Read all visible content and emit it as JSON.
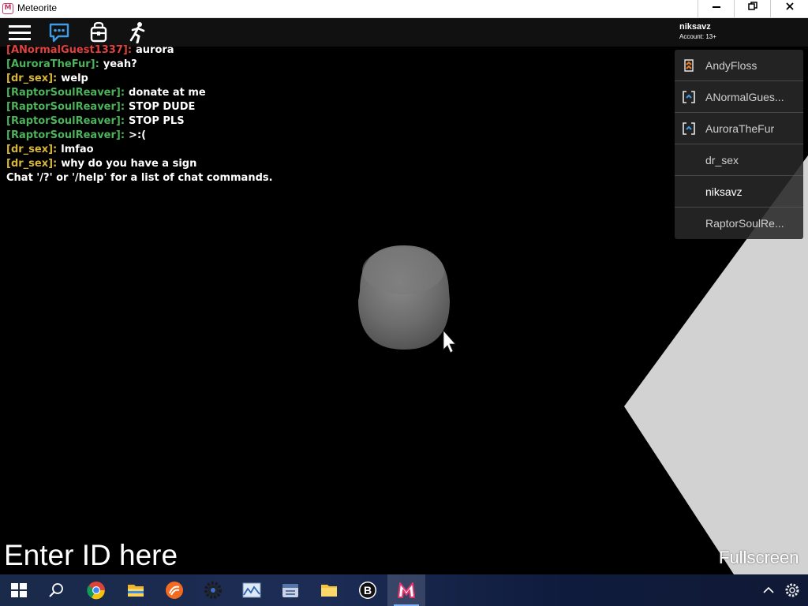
{
  "window": {
    "title": "Meteorite",
    "icon_letter": "M",
    "controls": [
      "minimize",
      "maximize",
      "close"
    ]
  },
  "account": {
    "name": "niksavz",
    "age_label": "Account: 13+"
  },
  "chat": {
    "messages": [
      {
        "name": "[ANormalGuest1337]:",
        "text": "aurora",
        "color": "#e0413d"
      },
      {
        "name": "[AuroraTheFur]:",
        "text": "yeah?",
        "color": "#4cb35a"
      },
      {
        "name": "[dr_sex]:",
        "text": "welp",
        "color": "#d8b63a"
      },
      {
        "name": "[RaptorSoulReaver]:",
        "text": "donate at me",
        "color": "#4cb35a"
      },
      {
        "name": "[RaptorSoulReaver]:",
        "text": "STOP DUDE",
        "color": "#4cb35a"
      },
      {
        "name": "[RaptorSoulReaver]:",
        "text": "STOP PLS",
        "color": "#4cb35a"
      },
      {
        "name": "[RaptorSoulReaver]:",
        "text": ">:(",
        "color": "#4cb35a"
      },
      {
        "name": "[dr_sex]:",
        "text": "lmfao",
        "color": "#d8b63a"
      },
      {
        "name": "[dr_sex]:",
        "text": "why do you have a sign",
        "color": "#d8b63a"
      }
    ],
    "system_message": "Chat '/?' or '/help' for a list of chat commands."
  },
  "players": [
    {
      "name": "AndyFloss",
      "icon": "premium-chevron-icon"
    },
    {
      "name": "ANormalGues...",
      "icon": "bracket-icon"
    },
    {
      "name": "AuroraTheFur",
      "icon": "bracket-icon"
    },
    {
      "name": "dr_sex",
      "icon": ""
    },
    {
      "name": "niksavz",
      "icon": ""
    },
    {
      "name": "RaptorSoulRe...",
      "icon": ""
    }
  ],
  "enter_id_label": "Enter ID here",
  "fullscreen_label": "Fullscreen",
  "colors": {
    "viewport_bg": "#000000",
    "ramp": "#cfcfcf",
    "cylinder": "#6e6e6e",
    "taskbar": "#1c2c55"
  },
  "taskbar": {
    "items": [
      "windows-start",
      "search",
      "chrome",
      "file-explorer",
      "app-orange",
      "settings-dark",
      "photo-app",
      "archive-app",
      "folder",
      "b-app",
      "meteorite"
    ],
    "active": "meteorite"
  }
}
